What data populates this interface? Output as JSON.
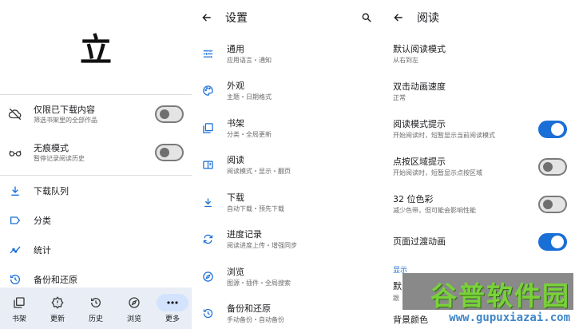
{
  "colors": {
    "accent": "#1a6fd6",
    "nav_bg": "#e9eef6",
    "subtext": "#6b6b6b",
    "watermark_green": "#7ad13a"
  },
  "library": {
    "logo": "立",
    "toggles": [
      {
        "label": "仅限已下载内容",
        "desc": "筛选书架里的全部作品",
        "icon": "cloud-off-icon",
        "on": false
      },
      {
        "label": "无痕模式",
        "desc": "暂停记录阅读历史",
        "icon": "glasses-icon",
        "on": false
      }
    ],
    "items": [
      {
        "label": "下载队列",
        "icon": "download-icon"
      },
      {
        "label": "分类",
        "icon": "label-icon"
      },
      {
        "label": "统计",
        "icon": "stats-icon"
      },
      {
        "label": "备份和还原",
        "icon": "restore-icon"
      }
    ],
    "nav": [
      {
        "label": "书架",
        "icon": "library-icon"
      },
      {
        "label": "更新",
        "icon": "updates-icon"
      },
      {
        "label": "历史",
        "icon": "history-icon"
      },
      {
        "label": "浏览",
        "icon": "compass-icon"
      },
      {
        "label": "更多",
        "icon": "more-icon",
        "active": true
      }
    ]
  },
  "settings": {
    "title": "设置",
    "items": [
      {
        "label": "通用",
        "desc": "应用语言・通知",
        "icon": "tune-icon"
      },
      {
        "label": "外观",
        "desc": "主题・日期格式",
        "icon": "palette-icon"
      },
      {
        "label": "书架",
        "desc": "分类・全局更新",
        "icon": "library-icon"
      },
      {
        "label": "阅读",
        "desc": "阅读模式・显示・翻页",
        "icon": "reader-icon"
      },
      {
        "label": "下载",
        "desc": "自动下载・预先下载",
        "icon": "download-icon"
      },
      {
        "label": "进度记录",
        "desc": "阅读进度上传・增强同步",
        "icon": "sync-icon"
      },
      {
        "label": "浏览",
        "desc": "图源・插件・全局搜索",
        "icon": "compass-icon"
      },
      {
        "label": "备份和还原",
        "desc": "手动备份・自动备份",
        "icon": "restore-icon"
      }
    ]
  },
  "reader": {
    "title": "阅读",
    "items": [
      {
        "label": "默认阅读模式",
        "desc": "从右到左"
      },
      {
        "label": "双击动画速度",
        "desc": "正常"
      },
      {
        "label": "阅读模式提示",
        "desc": "开始阅读时，短暂显示当前阅读模式",
        "toggle": true,
        "on": true
      },
      {
        "label": "点按区域提示",
        "desc": "开始阅读时，短暂显示点按区域",
        "toggle": true,
        "on": false
      },
      {
        "label": "32 位色彩",
        "desc": "减少色带，但可能会影响性能",
        "toggle": true,
        "on": false
      },
      {
        "label": "页面过渡动画",
        "desc": "",
        "toggle": true,
        "on": true
      }
    ],
    "section": "显示",
    "partial": [
      "默",
      "跟",
      "背景颜色"
    ]
  },
  "watermark": {
    "text": "谷普软件园",
    "url": "www.gupuxiazai.com"
  }
}
